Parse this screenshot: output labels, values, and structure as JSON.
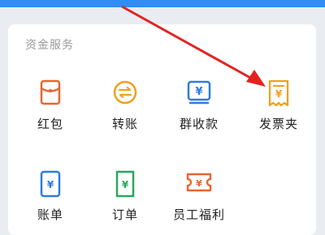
{
  "section": {
    "title": "资金服务"
  },
  "items": [
    {
      "label": "红包",
      "icon": "red-envelope-icon",
      "color": "#e8652f"
    },
    {
      "label": "转账",
      "icon": "transfer-icon",
      "color": "#f0a020"
    },
    {
      "label": "群收款",
      "icon": "group-collect-icon",
      "color": "#2f7be0"
    },
    {
      "label": "发票夹",
      "icon": "invoice-folder-icon",
      "color": "#f0a020"
    },
    {
      "label": "账单",
      "icon": "bill-icon",
      "color": "#2f7be0"
    },
    {
      "label": "订单",
      "icon": "order-icon",
      "color": "#27a85a"
    },
    {
      "label": "员工福利",
      "icon": "employee-benefit-icon",
      "color": "#e8652f"
    }
  ],
  "colors": {
    "accent": "#2f8df5",
    "arrow": "#e32222"
  }
}
